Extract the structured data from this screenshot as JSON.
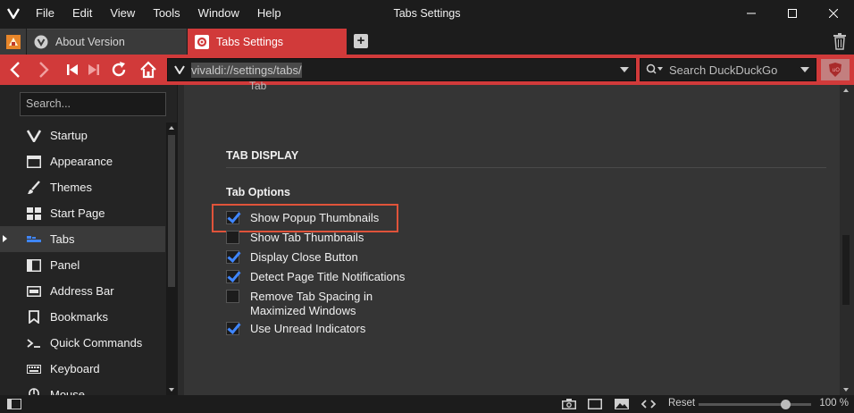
{
  "window": {
    "title": "Tabs Settings",
    "menu": [
      "File",
      "Edit",
      "View",
      "Tools",
      "Window",
      "Help"
    ]
  },
  "tabs": [
    {
      "label": "About Version",
      "icon": "vivaldi-icon",
      "active": false
    },
    {
      "label": "Tabs Settings",
      "icon": "gear-icon",
      "active": true
    }
  ],
  "address": {
    "url": "vivaldi://settings/tabs/",
    "search_placeholder": "Search DuckDuckGo"
  },
  "sidebar": {
    "search_placeholder": "Search...",
    "items": [
      {
        "label": "Startup",
        "icon": "vivaldi-v-icon"
      },
      {
        "label": "Appearance",
        "icon": "window-icon"
      },
      {
        "label": "Themes",
        "icon": "brush-icon"
      },
      {
        "label": "Start Page",
        "icon": "grid-icon"
      },
      {
        "label": "Tabs",
        "icon": "tabs-icon"
      },
      {
        "label": "Panel",
        "icon": "panel-icon"
      },
      {
        "label": "Address Bar",
        "icon": "address-bar-icon"
      },
      {
        "label": "Bookmarks",
        "icon": "bookmark-icon"
      },
      {
        "label": "Quick Commands",
        "icon": "quick-commands-icon"
      },
      {
        "label": "Keyboard",
        "icon": "keyboard-icon"
      },
      {
        "label": "Mouse",
        "icon": "mouse-icon"
      }
    ],
    "active_index": 4
  },
  "content": {
    "cut_text": "Tab",
    "section_title": "TAB DISPLAY",
    "group_title": "Tab Options",
    "options": [
      {
        "label": "Show Popup Thumbnails",
        "checked": true
      },
      {
        "label": "Show Tab Thumbnails",
        "checked": false
      },
      {
        "label": "Display Close Button",
        "checked": true
      },
      {
        "label": "Detect Page Title Notifications",
        "checked": true
      },
      {
        "label": "Remove Tab Spacing in",
        "label2": "Maximized Windows",
        "checked": false
      },
      {
        "label": "Use Unread Indicators",
        "checked": true
      }
    ]
  },
  "statusbar": {
    "reset_label": "Reset",
    "zoom": "100 %",
    "zoom_fraction": 0.8
  },
  "colors": {
    "accent": "#d13a3a",
    "checkbox": "#3f86ff",
    "highlight": "#e0533a"
  }
}
